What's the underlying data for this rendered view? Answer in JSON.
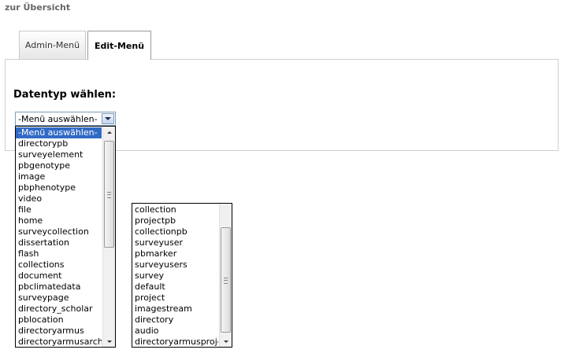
{
  "nav": {
    "back_label": "zur Übersicht"
  },
  "tabs": [
    {
      "label": "Admin-Menü",
      "active": false
    },
    {
      "label": "Edit-Menü",
      "active": true
    }
  ],
  "panel": {
    "heading": "Datentyp wählen:"
  },
  "select": {
    "value": "-Menü auswählen-"
  },
  "list1": {
    "items": [
      "-Menü auswählen-",
      "directorypb",
      "surveyelement",
      "pbgenotype",
      "image",
      "pbphenotype",
      "video",
      "file",
      "home",
      "surveycollection",
      "dissertation",
      "flash",
      "collections",
      "document",
      "pbclimatedata",
      "surveypage",
      "directory_scholar",
      "pblocation",
      "directoryarmus",
      "directoryarmusarch"
    ],
    "selected_index": 0
  },
  "list2": {
    "items": [
      "collection",
      "projectpb",
      "collectionpb",
      "surveyuser",
      "pbmarker",
      "surveyusers",
      "survey",
      "default",
      "project",
      "imagestream",
      "directory",
      "audio",
      "directoryarmusproject"
    ]
  },
  "icons": {
    "dropdown": "chevron-down-icon",
    "scroll_up": "arrow-up-icon",
    "scroll_down": "arrow-down-icon",
    "grip": "grip-icon"
  },
  "colors": {
    "selection": "#316ac5",
    "select_border": "#7f9db9"
  }
}
